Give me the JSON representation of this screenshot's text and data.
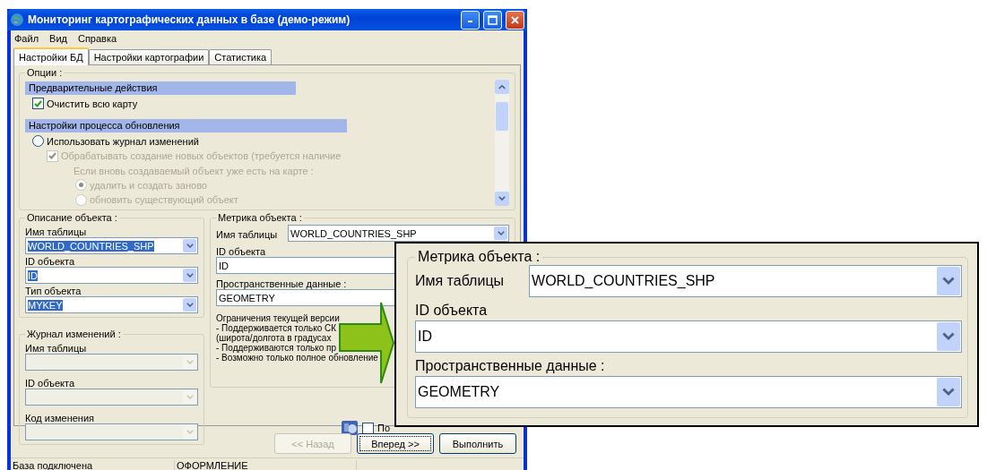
{
  "window": {
    "title": "Мониторинг картографических данных в базе (демо-режим)"
  },
  "menu": [
    "Файл",
    "Вид",
    "Справка"
  ],
  "tabs": [
    {
      "label": "Настройки БД",
      "selected": true
    },
    {
      "label": "Настройки картографии",
      "selected": false
    },
    {
      "label": "Статистика",
      "selected": false
    }
  ],
  "options": {
    "title": "Опции :",
    "sections": [
      {
        "header": "Предварительные действия",
        "items": [
          {
            "kind": "checkbox",
            "label": "Очистить всю карту",
            "checked": true,
            "disabled": false
          }
        ]
      },
      {
        "header": "Настройки процесса обновления",
        "items": [
          {
            "kind": "radio",
            "label": "Использовать журнал изменений",
            "checked": false,
            "disabled": false,
            "children": [
              {
                "kind": "checkbox",
                "label": "Обрабатывать создание новых объектов (требуется наличие",
                "checked": true,
                "disabled": true,
                "children": [
                  {
                    "kind": "note",
                    "label": "Если вновь создаваемый объект уже есть на карте :",
                    "disabled": true,
                    "children": [
                      {
                        "kind": "radio",
                        "label": "удалить и создать заново",
                        "checked": true,
                        "disabled": true
                      },
                      {
                        "kind": "radio",
                        "label": "обновить существующий объект",
                        "checked": false,
                        "disabled": true
                      }
                    ]
                  }
                ]
              }
            ]
          }
        ]
      }
    ]
  },
  "object_description": {
    "title": "Описание объекта :",
    "fields": [
      {
        "label": "Имя таблицы",
        "value": "WORLD_COUNTRIES_SHP",
        "highlighted": true
      },
      {
        "label": "ID объекта",
        "value": "ID",
        "highlighted": true
      },
      {
        "label": "Тип объекта",
        "value": "MYKEY",
        "highlighted": true
      }
    ]
  },
  "change_log": {
    "title": "Журнал изменений :",
    "fields": [
      {
        "label": "Имя таблицы",
        "disabled": true
      },
      {
        "label": "ID объекта",
        "disabled": true
      },
      {
        "label": "Код изменения",
        "disabled": true
      }
    ]
  },
  "object_metric": {
    "title": "Метрика объекта :",
    "fields": [
      {
        "label": "Имя таблицы",
        "value": "WORLD_COUNTRIES_SHP",
        "kind": "inline"
      },
      {
        "label": "ID объекта",
        "value": "ID",
        "kind": "stacked"
      },
      {
        "label": "Пространственные данные :",
        "value": "GEOMETRY",
        "kind": "stacked"
      }
    ],
    "notes": [
      "Ограничения текущей версии",
      "- Поддерживается только СК",
      "(широта/долгота в градусах",
      "- Поддерживаются только пр",
      "- Возможно только полное обновление"
    ]
  },
  "extra_option": {
    "label": "По",
    "checked": false
  },
  "buttons": [
    {
      "label": "<< Назад",
      "disabled": true,
      "default": false
    },
    {
      "label": "Вперед >>",
      "disabled": false,
      "default": true
    },
    {
      "label": "Выполнить",
      "disabled": false,
      "default": false
    }
  ],
  "status_bar": [
    "База подключена",
    "ОФОРМЛЕНИЕ"
  ],
  "callout": {
    "title": "Метрика объекта :",
    "fields": [
      {
        "label": "Имя таблицы",
        "value": "WORLD_COUNTRIES_SHP",
        "kind": "inline"
      },
      {
        "label": "ID объекта",
        "value": "ID",
        "kind": "stacked"
      },
      {
        "label": "Пространственные данные :",
        "value": "GEOMETRY",
        "kind": "stacked"
      }
    ]
  }
}
